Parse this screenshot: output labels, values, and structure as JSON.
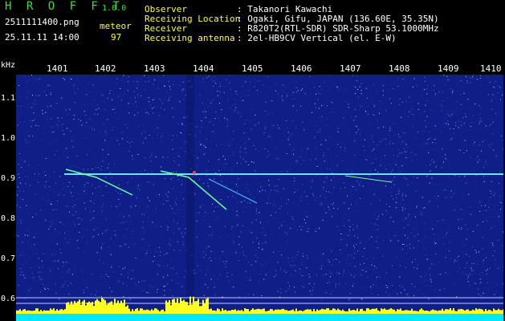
{
  "header": {
    "logo": "H R O F F T",
    "version": "1.0.0",
    "filename": "2511111400.png",
    "datetime": "25.11.11 14:00",
    "mode_label": "meteor",
    "count": "97",
    "observer_label": "Observer",
    "observer_value": ": Takanori Kawachi",
    "location_label": "Receiving Location",
    "location_value": ": Ogaki, Gifu, JAPAN (136.60E, 35.35N)",
    "receiver_label": "Receiver",
    "receiver_value": ": R820T2(RTL-SDR) SDR-Sharp 53.1000MHz",
    "antenna_label": "Receiving antenna",
    "antenna_value": ": 2el-HB9CV Vertical (el. E-W)"
  },
  "axis": {
    "unit": "kHz",
    "time_ticks": [
      "1401",
      "1402",
      "1403",
      "1404",
      "1405",
      "1406",
      "1407",
      "1408",
      "1409",
      "1410"
    ],
    "freq_ticks": [
      "1.1",
      "1.0",
      "0.9",
      "0.8",
      "0.7",
      "0.6"
    ]
  },
  "colors": {
    "background": "#101f88",
    "carrier": "#5fe8ff",
    "activity": "#ffff20",
    "floor": "#00e8ff"
  }
}
